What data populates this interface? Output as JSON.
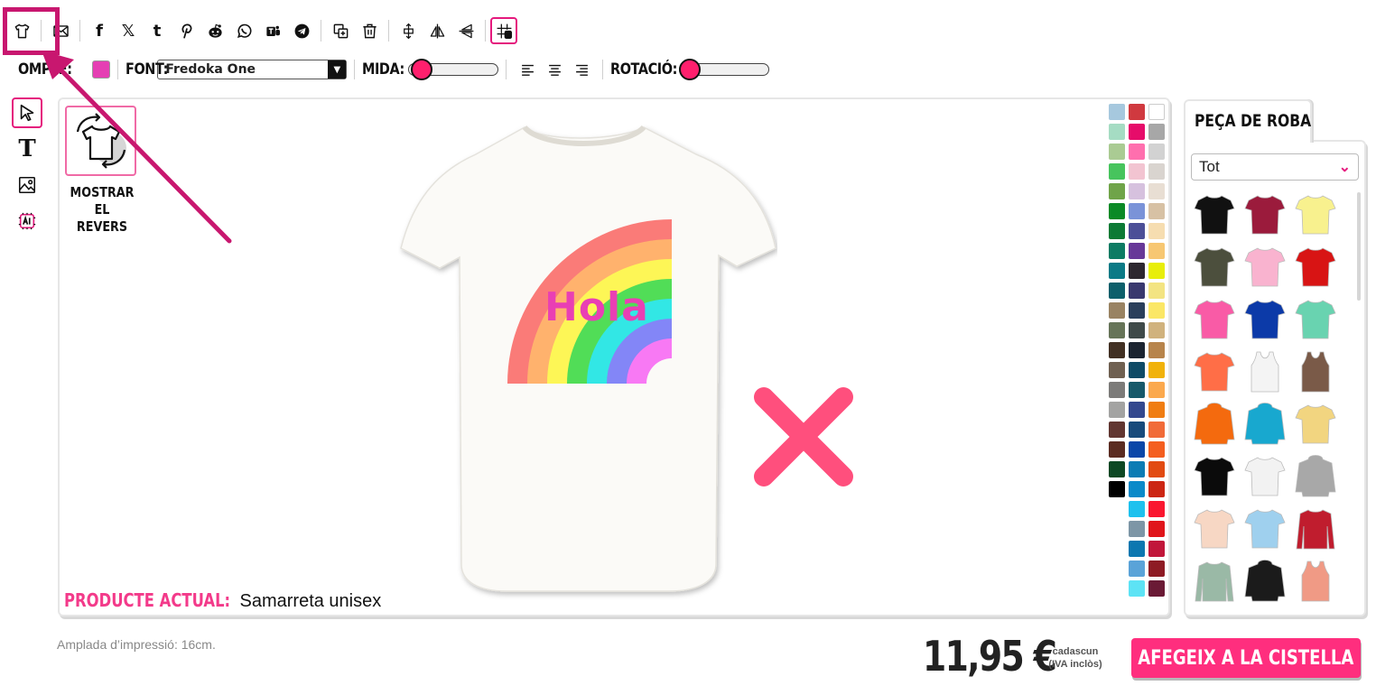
{
  "toolbar": {
    "buttons": [
      "tshirt-icon",
      "mail-icon",
      "facebook-icon",
      "x-icon",
      "tumblr-icon",
      "pinterest-icon",
      "reddit-icon",
      "whatsapp-icon",
      "teams-icon",
      "telegram-icon",
      "duplicate-icon",
      "trash-icon",
      "center-icon",
      "flip-horizontal-icon",
      "flip-vertical-icon",
      "grid-icon"
    ],
    "facebook_glyph": "f",
    "x_glyph": "𝕏",
    "tumblr_glyph": "t"
  },
  "propbar": {
    "fill_label": "OMPLE:",
    "fill_color": "#e53fb3",
    "font_label": "FONT:",
    "font_value": "Fredoka One",
    "size_label": "MIDA:",
    "rotation_label": "ROTACIÓ:",
    "size_value": 0.1,
    "rotation_value": 0.1
  },
  "canvas": {
    "flip_label_line1": "MOSTRAR",
    "flip_label_line2": "EL REVERS",
    "design_text": "Hola",
    "product_label": "PRODUCTE ACTUAL:",
    "product_name": "Samarreta unisex",
    "palette_colors": [
      "#a6c8de",
      "#d0393f",
      "#ffffff",
      "#a5dcc3",
      "#e60c6a",
      "#a7a7a7",
      "#aacb93",
      "#ff6fae",
      "#d2d2d2",
      "#47c45d",
      "#f2c4d1",
      "#d9d4cf",
      "#6fa449",
      "#d6c1de",
      "#e8ded3",
      "#0b8a26",
      "#7a93d8",
      "#d7c1a4",
      "#0c7a35",
      "#4c4f97",
      "#f6ddb0",
      "#0d7b63",
      "#673898",
      "#f7c772",
      "#0b7a86",
      "#2d2830",
      "#e8ee0a",
      "#0d5f6b",
      "#39386e",
      "#f3e482",
      "#998363",
      "#2a3f5b",
      "#fbe765",
      "#667458",
      "#3f4a49",
      "#d0b27d",
      "#413023",
      "#1b2430",
      "#b7844b",
      "#6f6051",
      "#0f4b66",
      "#f1b20a",
      "#7c7b79",
      "#17596a",
      "#fba94e",
      "#a3a3a2",
      "#33488e",
      "#f07d12",
      "#613631",
      "#184a7b",
      "#f16b38",
      "#5b2c22",
      "#0b47a8",
      "#f45e1f",
      "#0d4824",
      "#0c7cb4",
      "#e24b12",
      "#000000",
      "#0b8ac9",
      "#cc2613",
      "",
      "#1ec1ee",
      "#fa1730",
      "",
      "#7d96a6",
      "#e0151b",
      "",
      "#0c77b0",
      "#c1163a",
      "",
      "#5aa3d8",
      "#8e1b24",
      "",
      "#5de3f5",
      "#6a1a35"
    ]
  },
  "panel": {
    "tab_label": "PEÇA DE ROBA",
    "category_value": "Tot",
    "garments": [
      {
        "name": "black-tshirt",
        "color": "#111111"
      },
      {
        "name": "burgundy-tshirt",
        "color": "#9b1b3c"
      },
      {
        "name": "yellow-tshirt",
        "color": "#f8f18e"
      },
      {
        "name": "olive-tshirt",
        "color": "#4c4f3d"
      },
      {
        "name": "pink-tshirt",
        "color": "#f9b3cf"
      },
      {
        "name": "red-tshirt",
        "color": "#d81414"
      },
      {
        "name": "fuchsia-tshirt",
        "color": "#f95ba6"
      },
      {
        "name": "royal-tshirt",
        "color": "#0c3aa8"
      },
      {
        "name": "mint-tshirt",
        "color": "#69d3b0"
      },
      {
        "name": "coral-tshirt",
        "color": "#ff6e47"
      },
      {
        "name": "white-tank",
        "color": "#f4f4f4"
      },
      {
        "name": "brown-tank",
        "color": "#7a5a48"
      },
      {
        "name": "orange-hoodie",
        "color": "#f46a0e"
      },
      {
        "name": "turquoise-hoodie",
        "color": "#18a8cf"
      },
      {
        "name": "tiedye-tshirt",
        "color": "#f2d580"
      },
      {
        "name": "black-tshirt-2",
        "color": "#0b0b0b"
      },
      {
        "name": "raglan-tshirt",
        "color": "#f2f2f2"
      },
      {
        "name": "grey-hoodie",
        "color": "#a8a8a8"
      },
      {
        "name": "peach-tshirt",
        "color": "#f7d7c4"
      },
      {
        "name": "dipdye-tshirt",
        "color": "#9fd0ee"
      },
      {
        "name": "varsity-jacket",
        "color": "#c01d2e"
      },
      {
        "name": "sage-longsleeve",
        "color": "#9ab9a6"
      },
      {
        "name": "black-orange-hoodie",
        "color": "#1b1b1b"
      },
      {
        "name": "salmon-tank",
        "color": "#f09a85"
      }
    ]
  },
  "footer": {
    "print_width": "Amplada d’impressió: 16cm.",
    "price": "11,95 €",
    "price_note_line1": "cadascun",
    "price_note_line2": "(IVA inclòs)",
    "cart_label": "AFEGEIX A LA CISTELLA"
  }
}
